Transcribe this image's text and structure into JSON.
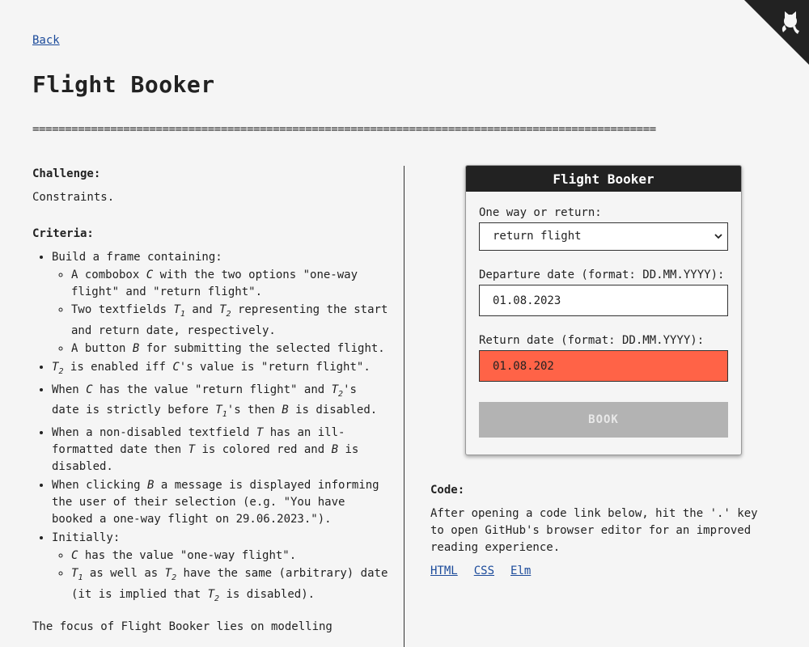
{
  "nav": {
    "back_label": "Back"
  },
  "page": {
    "title": "Flight Booker",
    "divider": "================================================================================================"
  },
  "challenge": {
    "heading": "Challenge:",
    "text": "Constraints."
  },
  "criteria": {
    "heading": "Criteria:"
  },
  "focus_text": "The focus of Flight Booker lies on modelling",
  "widget": {
    "title": "Flight Booker",
    "trip_type_label": "One way or return:",
    "trip_type_value": "return flight",
    "departure_label": "Departure date (format: DD.MM.YYYY):",
    "departure_value": "01.08.2023",
    "return_label": "Return date (format: DD.MM.YYYY):",
    "return_value": "01.08.202",
    "book_label": "BOOK",
    "invalid_color": "#ff6347",
    "disabled_button_color": "#b3b3b3"
  },
  "code": {
    "heading": "Code:",
    "text": "After opening a code link below, hit the '.' key to open GitHub's browser editor for an improved reading experience.",
    "links": [
      "HTML",
      "CSS",
      "Elm"
    ]
  },
  "github_corner": {
    "icon": "octocat-icon"
  }
}
